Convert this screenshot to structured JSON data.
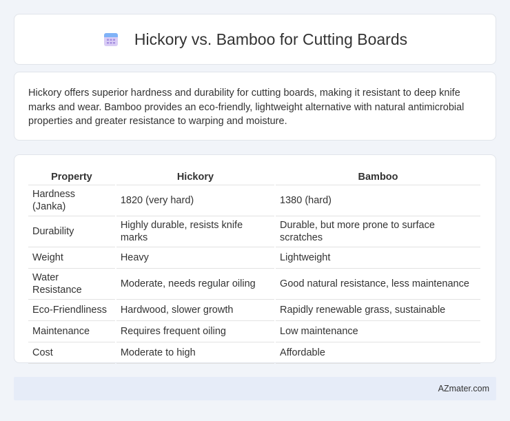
{
  "header": {
    "title": "Hickory vs. Bamboo for Cutting Boards",
    "icon": "calendar-icon"
  },
  "summary": {
    "text": "Hickory offers superior hardness and durability for cutting boards, making it resistant to deep knife marks and wear. Bamboo provides an eco-friendly, lightweight alternative with natural antimicrobial properties and greater resistance to warping and moisture."
  },
  "table": {
    "headers": [
      "Property",
      "Hickory",
      "Bamboo"
    ],
    "rows": [
      [
        "Hardness (Janka)",
        "1820 (very hard)",
        "1380 (hard)"
      ],
      [
        "Durability",
        "Highly durable, resists knife marks",
        "Durable, but more prone to surface scratches"
      ],
      [
        "Weight",
        "Heavy",
        "Lightweight"
      ],
      [
        "Water Resistance",
        "Moderate, needs regular oiling",
        "Good natural resistance, less maintenance"
      ],
      [
        "Eco-Friendliness",
        "Hardwood, slower growth",
        "Rapidly renewable grass, sustainable"
      ],
      [
        "Maintenance",
        "Requires frequent oiling",
        "Low maintenance"
      ],
      [
        "Cost",
        "Moderate to high",
        "Affordable"
      ]
    ]
  },
  "footer": {
    "text": "AZmater.com"
  },
  "colors": {
    "background": "#f1f4f9",
    "card": "#ffffff",
    "footer": "#e6ecf8",
    "icon_top": "#6fa8f5",
    "icon_body": "#c9b8f0"
  }
}
